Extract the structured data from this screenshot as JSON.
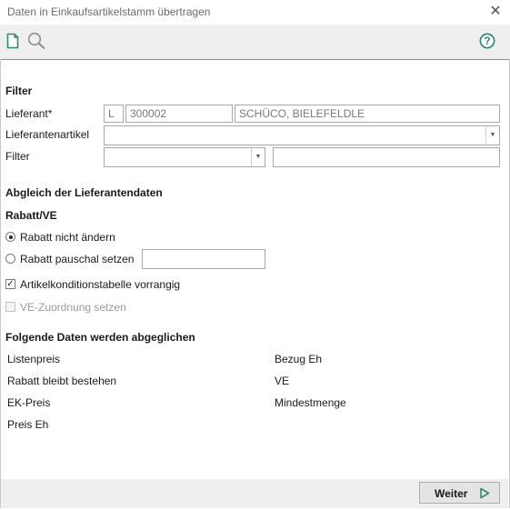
{
  "window": {
    "title": "Daten in Einkaufsartikelstamm übertragen",
    "close_glyph": "✕"
  },
  "toolbar": {
    "icons": [
      "new-document-icon",
      "search-icon",
      "help-icon"
    ],
    "help_glyph": "?"
  },
  "filter": {
    "heading": "Filter",
    "lieferant_label": "Lieferant*",
    "lieferant_prefix": "L",
    "lieferant_number": "300002",
    "lieferant_name": "SCHÜCO, BIELEFELDLE",
    "lieferantenartikel_label": "Lieferantenartikel",
    "lieferantenartikel_value": "",
    "filter_label": "Filter",
    "filter_select_value": "",
    "filter_text_value": ""
  },
  "abgleich": {
    "heading": "Abgleich der Lieferantendaten",
    "rabatt_heading": "Rabatt/VE",
    "radio_keep": "Rabatt nicht ändern",
    "radio_keep_selected": true,
    "radio_flat": "Rabatt pauschal setzen",
    "radio_flat_value": "",
    "check_table": "Artikelkonditionstabelle vorrangig",
    "check_table_checked": true,
    "check_table_mark": "✓",
    "check_ve": "VE-Zuordnung setzen",
    "check_ve_disabled": true
  },
  "data_list": {
    "heading": "Folgende Daten werden abgeglichen",
    "left": [
      "Listenpreis",
      "Rabatt bleibt bestehen",
      "EK-Preis",
      "Preis Eh"
    ],
    "right": [
      "Bezug Eh",
      "VE",
      "Mindestmenge"
    ]
  },
  "footer": {
    "weiter_label": "Weiter",
    "accent": "#2e8b74"
  }
}
